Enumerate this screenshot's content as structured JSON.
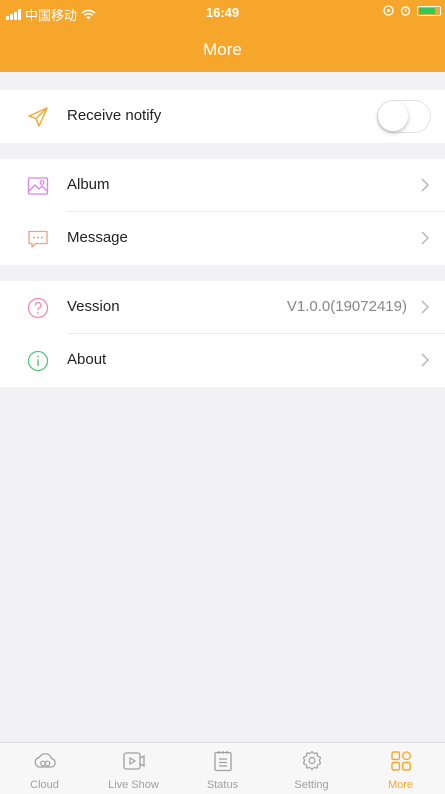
{
  "status_bar": {
    "carrier": "中国移动",
    "time": "16:49",
    "battery_color": "#34c759"
  },
  "header": {
    "title": "More",
    "background": "#f6a72b"
  },
  "sections": [
    {
      "items": [
        {
          "icon": "paper-plane-icon",
          "label": "Receive notify",
          "control": "toggle",
          "toggle_on": false
        }
      ]
    },
    {
      "items": [
        {
          "icon": "album-icon",
          "label": "Album",
          "control": "chevron"
        },
        {
          "icon": "message-icon",
          "label": "Message",
          "control": "chevron"
        }
      ]
    },
    {
      "items": [
        {
          "icon": "question-icon",
          "label": "Vession",
          "value": "V1.0.0(19072419)",
          "control": "chevron"
        },
        {
          "icon": "info-icon",
          "label": "About",
          "control": "chevron"
        }
      ]
    }
  ],
  "tabbar": {
    "active_color": "#f6a72b",
    "inactive_color": "#a0a0a0",
    "tabs": [
      {
        "label": "Cloud",
        "icon": "cloud-icon",
        "active": false
      },
      {
        "label": "Live Show",
        "icon": "video-icon",
        "active": false
      },
      {
        "label": "Status",
        "icon": "status-list-icon",
        "active": false
      },
      {
        "label": "Setting",
        "icon": "gear-icon",
        "active": false
      },
      {
        "label": "More",
        "icon": "grid-icon",
        "active": true
      }
    ]
  }
}
